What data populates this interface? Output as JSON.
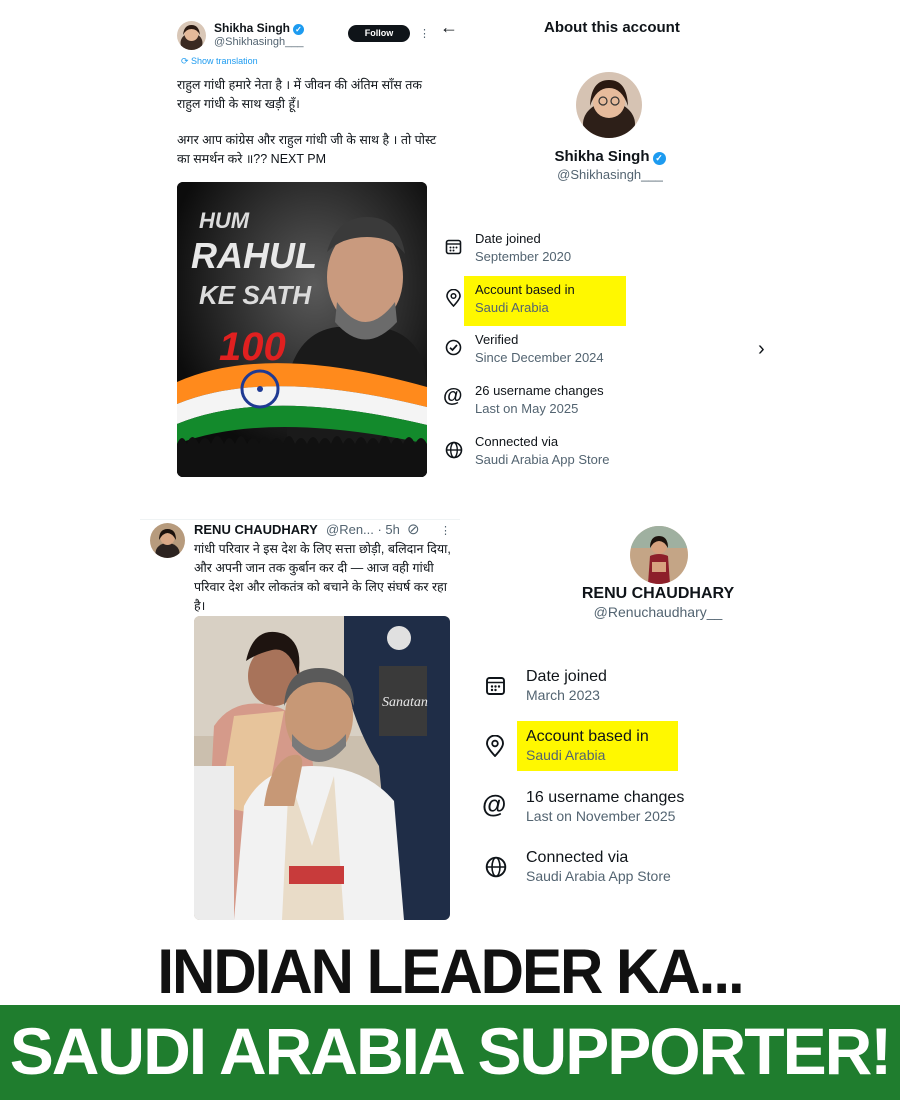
{
  "tweet1": {
    "name": "Shikha Singh",
    "handle": "@Shikhasingh___",
    "follow_label": "Follow",
    "more_label": "⋮",
    "show_translation": "Show translation",
    "text_line1": "राहुल गांधी हमारे नेता है । में जीवन की अंतिम साँस तक राहुल गांधी के साथ खड़ी हूँ।",
    "text_line2": "अगर आप कांग्रेस और राहुल गांधी जी के साथ है । तो पोस्ट का समर्थन करे ॥?? NEXT PM",
    "image": {
      "line1": "HUM",
      "line2": "RAHUL",
      "line3": "KE SATH",
      "badge": "100"
    }
  },
  "about1": {
    "title": "About this account",
    "name": "Shikha Singh",
    "handle": "@Shikhasingh___",
    "rows": [
      {
        "icon": "calendar-icon",
        "label": "Date joined",
        "value": "September 2020"
      },
      {
        "icon": "location-pin-icon",
        "label": "Account based in",
        "value": "Saudi Arabia"
      },
      {
        "icon": "verified-badge-icon",
        "label": "Verified",
        "value": "Since December 2024"
      },
      {
        "icon": "at-sign-icon",
        "label": "26 username changes",
        "value": "Last on May 2025"
      },
      {
        "icon": "globe-icon",
        "label": "Connected via",
        "value": "Saudi Arabia App Store"
      }
    ],
    "highlight_color": "#fff800"
  },
  "tweet2": {
    "name": "RENU CHAUDHARY",
    "meta": "@Ren... · 5h",
    "more_label": "⋮",
    "text": "गांधी परिवार ने इस देश के लिए सत्ता छोड़ी, बलिदान दिया, और अपनी जान तक कुर्बान कर दी — आज वही गांधी परिवार देश और लोकतंत्र को बचाने के लिए संघर्ष कर रहा है।",
    "image": {
      "cap_text": "Sanatan"
    }
  },
  "about2": {
    "name": "RENU CHAUDHARY",
    "handle": "@Renuchaudhary__",
    "rows": [
      {
        "icon": "calendar-icon",
        "label": "Date joined",
        "value": "March 2023"
      },
      {
        "icon": "location-pin-icon",
        "label": "Account based in",
        "value": "Saudi Arabia"
      },
      {
        "icon": "at-sign-icon",
        "label": "16 username changes",
        "value": "Last on November 2025"
      },
      {
        "icon": "globe-icon",
        "label": "Connected via",
        "value": "Saudi Arabia App Store"
      }
    ]
  },
  "banner": {
    "headline": "INDIAN LEADER KA...",
    "subline": "SAUDI ARABIA SUPPORTER!",
    "green": "#1f7d2e"
  }
}
